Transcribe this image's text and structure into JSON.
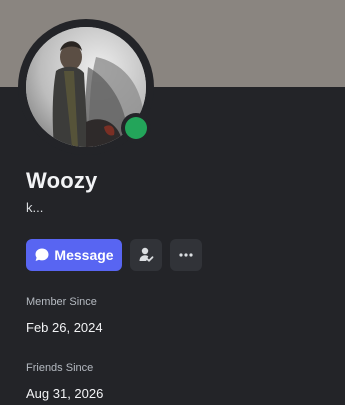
{
  "profile": {
    "display_name": "Woozy",
    "custom_status": "k...",
    "status": "online"
  },
  "actions": {
    "message_label": "Message",
    "message_icon": "chat-bubble-icon",
    "friend_icon": "friend-check-icon",
    "more_icon": "more-dots-icon"
  },
  "member_since": {
    "label": "Member Since",
    "value": "Feb 26, 2024"
  },
  "friends_since": {
    "label": "Friends Since",
    "value": "Aug 31, 2026"
  },
  "colors": {
    "banner": "#8a8580",
    "panel": "#232428",
    "accent": "#5865f2",
    "online": "#23a55a"
  }
}
